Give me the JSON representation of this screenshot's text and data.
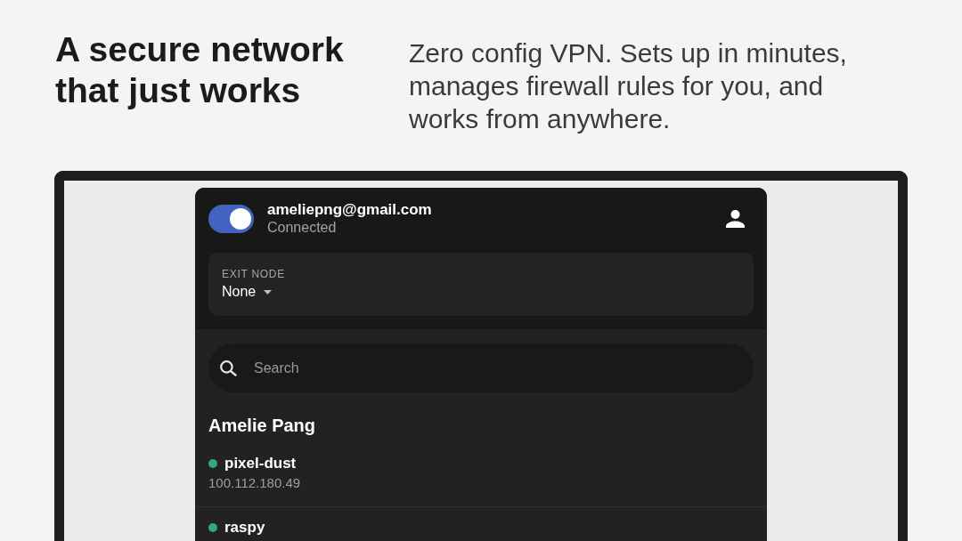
{
  "hero": {
    "headline": "A secure network that just works",
    "description": "Zero config VPN. Sets up in minutes, manages firewall rules for you, and works from anywhere."
  },
  "app": {
    "header": {
      "vpn_toggle": {
        "on": true
      },
      "account": "ameliepng@gmail.com",
      "status": "Connected"
    },
    "exit_node": {
      "label": "EXIT NODE",
      "value": "None"
    },
    "search": {
      "placeholder": "Search"
    },
    "owner": "Amelie Pang",
    "devices": [
      {
        "name": "pixel-dust",
        "address": "100.112.180.49",
        "online": true
      },
      {
        "name": "raspy",
        "online": true
      }
    ]
  }
}
